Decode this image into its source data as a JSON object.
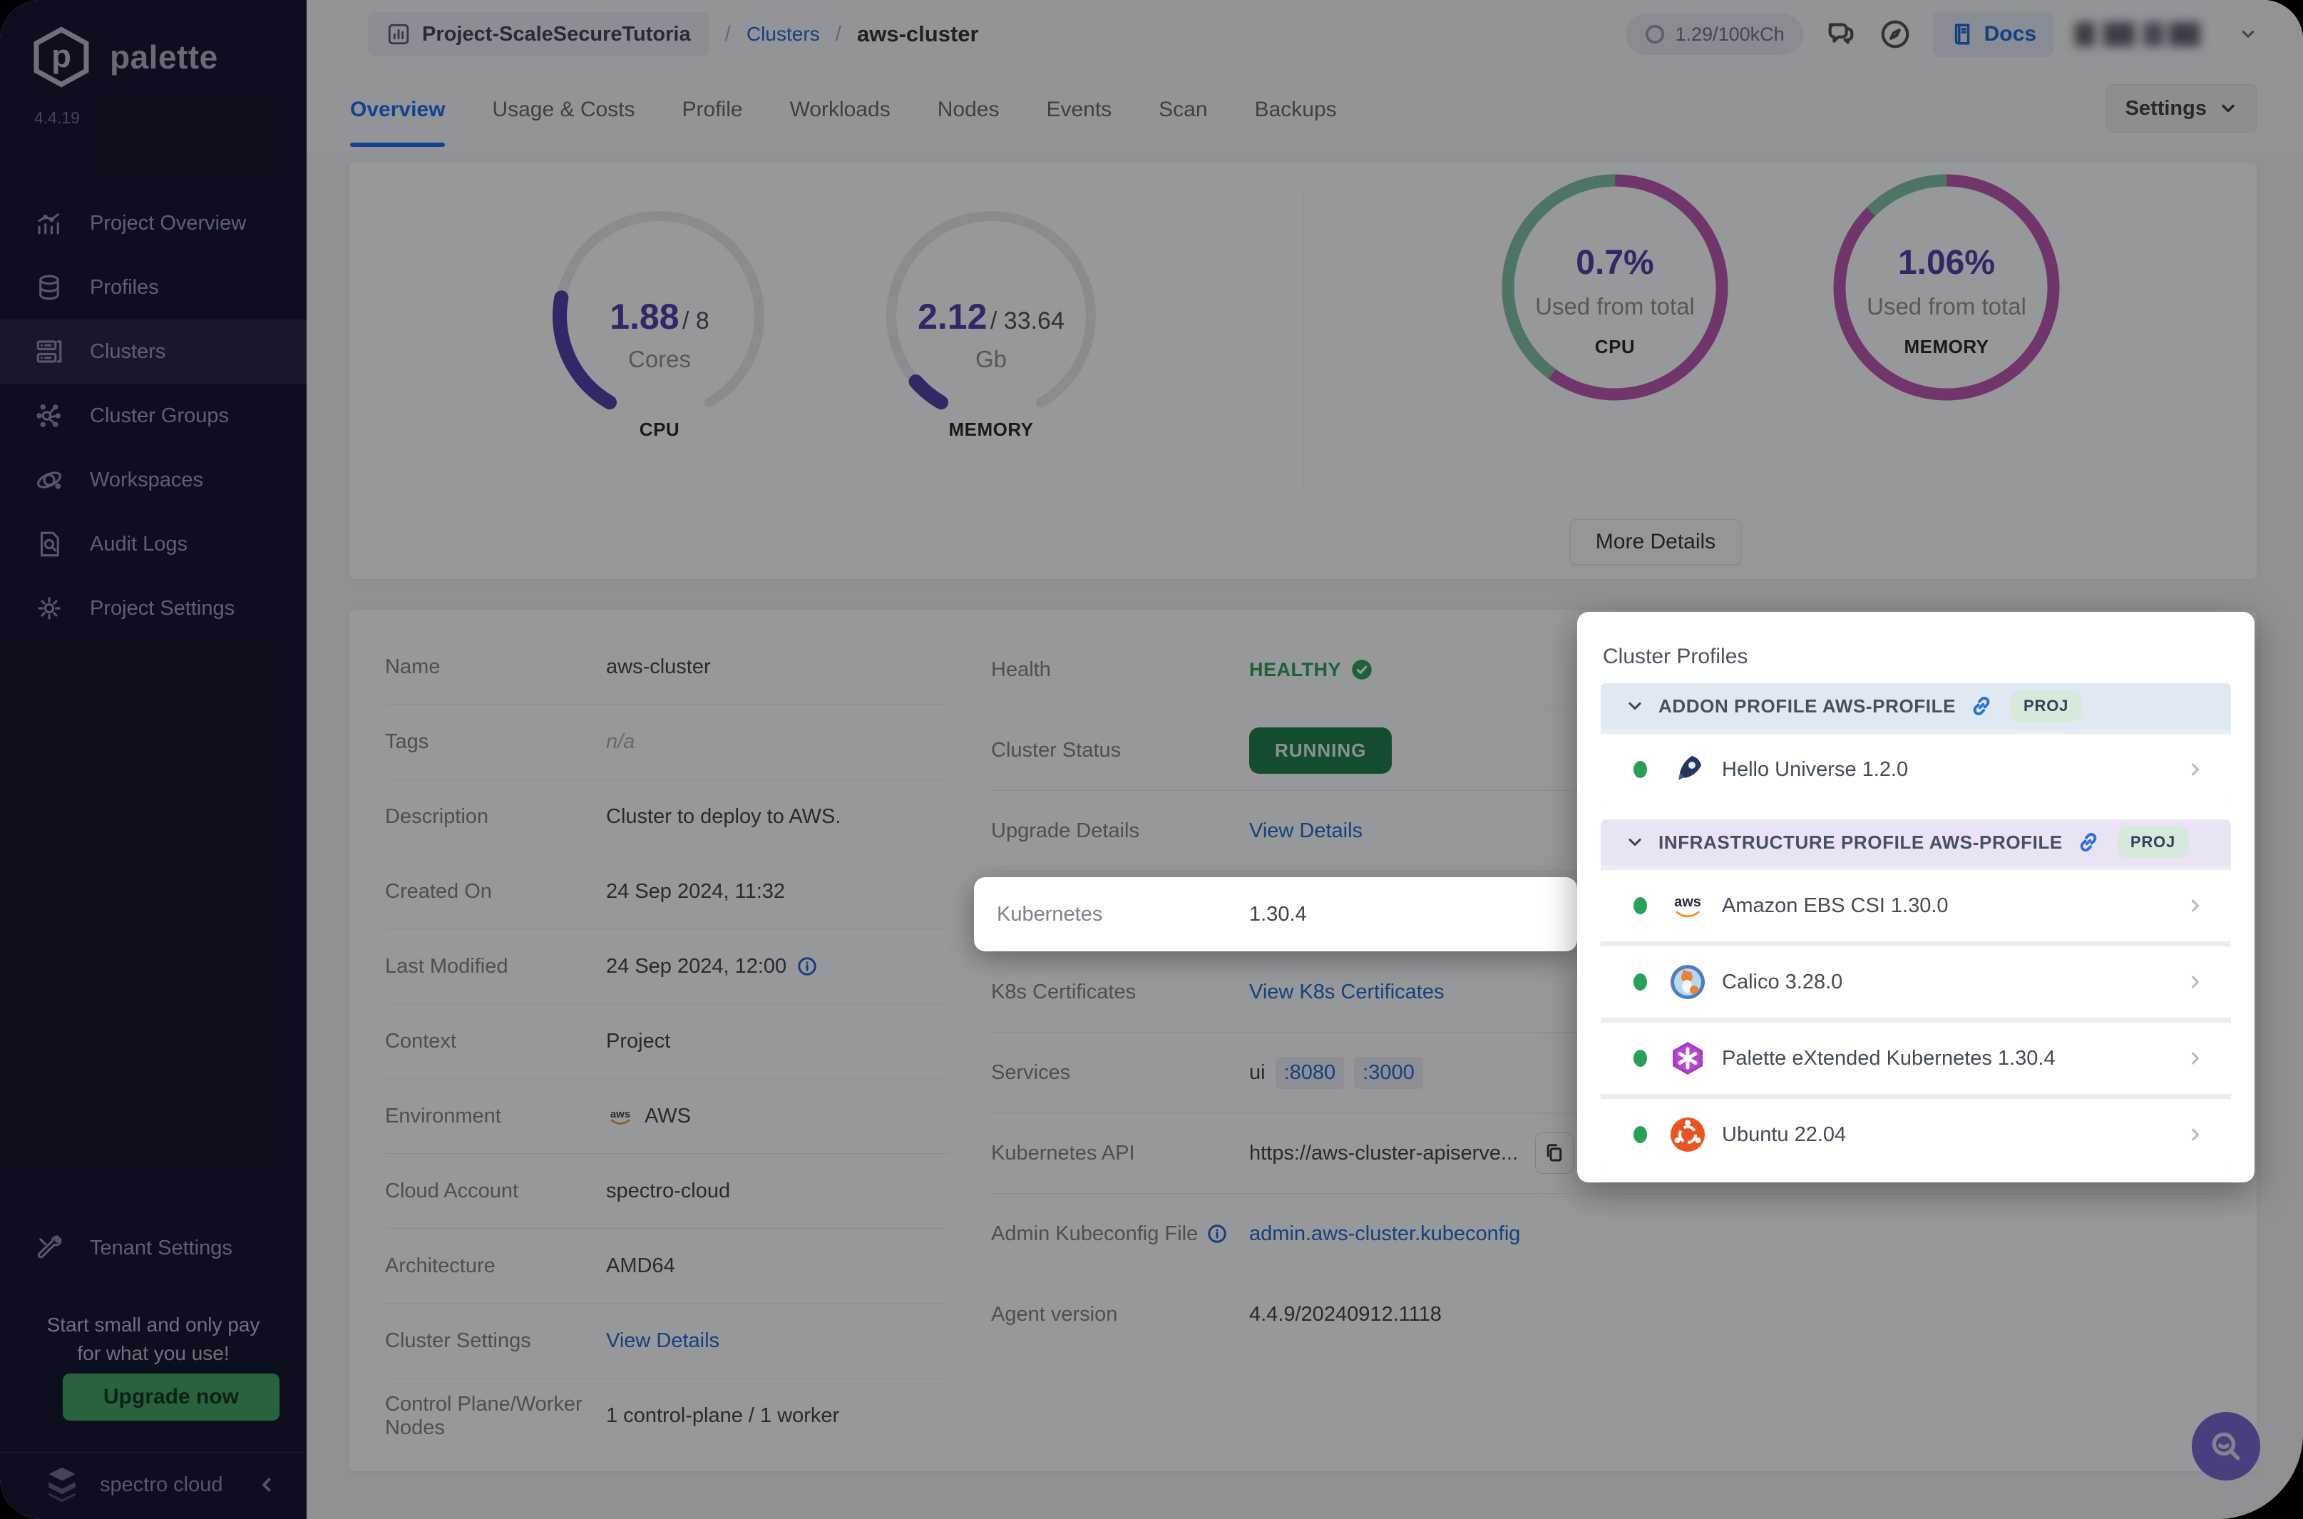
{
  "brand": {
    "name": "palette",
    "version": "4.4.19",
    "footer": "spectro cloud"
  },
  "colors": {
    "accent": "#1a6fe8",
    "link": "#2068d0",
    "sidebar_bg": "#14142a",
    "sidebar_active": "#23233d",
    "sidebar_text": "#9ba0b5",
    "upgrade_green": "#42a45f",
    "running_green": "#1e7e46",
    "healthy_green": "#2aa05b",
    "indigo": "#4a41a8",
    "donut_magenta": "#bc57ae",
    "donut_green": "#7fc4a0",
    "gauge_track": "#e8e8ef",
    "header1_bg": "#dee9f2",
    "header2_bg": "#eae3f4",
    "badge_bg": "#d7e9dd",
    "dot_green": "#27a158",
    "fab_bg": "#7468cf"
  },
  "sidebar": {
    "items": [
      {
        "label": "Project Overview"
      },
      {
        "label": "Profiles"
      },
      {
        "label": "Clusters"
      },
      {
        "label": "Cluster Groups"
      },
      {
        "label": "Workspaces"
      },
      {
        "label": "Audit Logs"
      },
      {
        "label": "Project Settings"
      }
    ],
    "tenant_settings": "Tenant Settings",
    "promo_line1": "Start small and only pay",
    "promo_line2": "for what you use!",
    "upgrade_label": "Upgrade now"
  },
  "header": {
    "project": "Project-ScaleSecureTutoria",
    "sep1": "/",
    "sep2": "/",
    "breadcrumb_link": "Clusters",
    "breadcrumb_current": "aws-cluster",
    "usage_pill": "1.29/100kCh",
    "docs_label": "Docs"
  },
  "tabs": {
    "items": [
      "Overview",
      "Usage & Costs",
      "Profile",
      "Workloads",
      "Nodes",
      "Events",
      "Scan",
      "Backups"
    ],
    "settings_label": "Settings"
  },
  "summary": {
    "gauges": [
      {
        "metric": "CPU",
        "value": "1.88",
        "total": "/ 8",
        "unit": "Cores",
        "fraction": 0.235
      },
      {
        "metric": "MEMORY",
        "value": "2.12",
        "total": "/ 33.64",
        "unit": "Gb",
        "fraction": 0.063
      }
    ],
    "donuts": [
      {
        "metric": "CPU",
        "value": "0.7%",
        "caption": "Used from total",
        "secondary_fraction": 0.4
      },
      {
        "metric": "MEMORY",
        "value": "1.06%",
        "caption": "Used from total",
        "secondary_fraction": 0.125
      }
    ],
    "more_details_label": "More Details"
  },
  "details": {
    "left": [
      {
        "label": "Name",
        "value": "aws-cluster"
      },
      {
        "label": "Tags",
        "value": "n/a"
      },
      {
        "label": "Description",
        "value": "Cluster to deploy to AWS."
      },
      {
        "label": "Created On",
        "value": "24 Sep 2024, 11:32"
      },
      {
        "label": "Last Modified",
        "value": "24 Sep 2024, 12:00"
      },
      {
        "label": "Context",
        "value": "Project"
      },
      {
        "label": "Environment",
        "value": "AWS"
      },
      {
        "label": "Cloud Account",
        "value": "spectro-cloud"
      },
      {
        "label": "Architecture",
        "value": "AMD64"
      },
      {
        "label": "Cluster Settings",
        "value": "View Details"
      },
      {
        "label": "Control Plane/Worker Nodes",
        "value": "1 control-plane / 1 worker"
      }
    ],
    "right": [
      {
        "label": "Health",
        "value": "HEALTHY"
      },
      {
        "label": "Cluster Status",
        "value": "RUNNING"
      },
      {
        "label": "Upgrade Details",
        "value": "View Details"
      },
      {
        "label": "Kubernetes",
        "value": "1.30.4"
      },
      {
        "label": "K8s Certificates",
        "value": "View K8s Certificates"
      },
      {
        "label": "Services",
        "value": "ui",
        "ports": [
          ":8080",
          ":3000"
        ]
      },
      {
        "label": "Kubernetes API",
        "value": "https://aws-cluster-apiserve..."
      },
      {
        "label": "Admin Kubeconfig File",
        "value": "admin.aws-cluster.kubeconfig"
      },
      {
        "label": "Agent version",
        "value": "4.4.9/20240912.1118"
      }
    ]
  },
  "profiles_panel": {
    "title": "Cluster Profiles",
    "sections": [
      {
        "header": "ADDON PROFILE AWS-PROFILE",
        "badge": "PROJ",
        "items": [
          {
            "name": "Hello Universe 1.2.0"
          }
        ]
      },
      {
        "header": "INFRASTRUCTURE PROFILE AWS-PROFILE",
        "badge": "PROJ",
        "items": [
          {
            "name": "Amazon EBS CSI 1.30.0"
          },
          {
            "name": "Calico 3.28.0"
          },
          {
            "name": "Palette eXtended Kubernetes 1.30.4"
          },
          {
            "name": "Ubuntu 22.04"
          }
        ]
      }
    ]
  }
}
